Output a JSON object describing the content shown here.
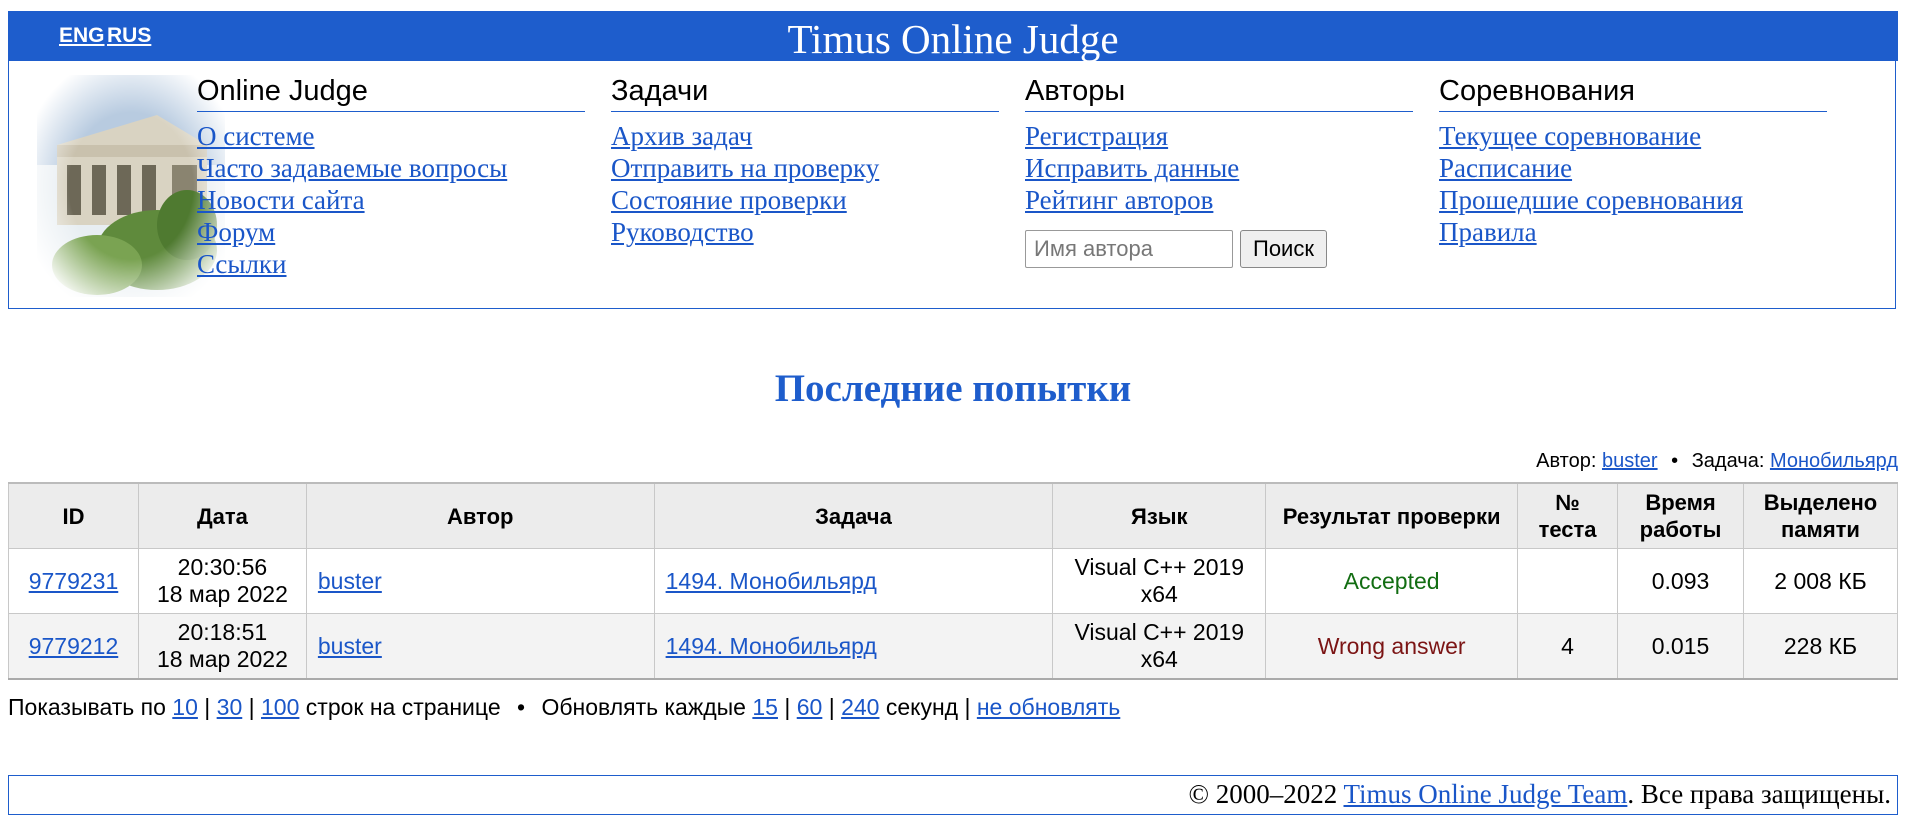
{
  "header": {
    "lang_eng": "ENG",
    "lang_rus": "RUS",
    "title": "Timus Online Judge",
    "bar_color": "#1e5dcc"
  },
  "nav": {
    "columns": [
      {
        "heading": "Online Judge",
        "links": [
          "О системе",
          "Часто задаваемые вопросы",
          "Новости сайта",
          "Форум",
          "Ссылки"
        ]
      },
      {
        "heading": "Задачи",
        "links": [
          "Архив задач",
          "Отправить на проверку",
          "Состояние проверки",
          "Руководство"
        ]
      },
      {
        "heading": "Авторы",
        "links": [
          "Регистрация",
          "Исправить данные",
          "Рейтинг авторов"
        ]
      },
      {
        "heading": "Соревнования",
        "links": [
          "Текущее соревнование",
          "Расписание",
          "Прошедшие соревнования",
          "Правила"
        ]
      }
    ],
    "search": {
      "placeholder": "Имя автора",
      "value": "",
      "button": "Поиск"
    }
  },
  "page_title": "Последние попытки",
  "filter": {
    "author_label": "Автор:",
    "author_value": "buster",
    "separator": "•",
    "problem_label": "Задача:",
    "problem_value": "Монобильярд"
  },
  "table": {
    "headers": {
      "id": "ID",
      "date": "Дата",
      "author": "Автор",
      "problem": "Задача",
      "language": "Язык",
      "verdict": "Результат проверки",
      "test_line1": "№",
      "test_line2": "теста",
      "time_line1": "Время",
      "time_line2": "работы",
      "memory_line1": "Выделено",
      "memory_line2": "памяти"
    },
    "rows": [
      {
        "id": "9779231",
        "time": "20:30:56",
        "date": "18 мар 2022",
        "author": "buster",
        "problem": "1494. Монобильярд",
        "lang_line1": "Visual C++ 2019",
        "lang_line2": "x64",
        "verdict": "Accepted",
        "test": "",
        "run_time": "0.093",
        "memory": "2 008 КБ"
      },
      {
        "id": "9779212",
        "time": "20:18:51",
        "date": "18 мар 2022",
        "author": "buster",
        "problem": "1494. Монобильярд",
        "lang_line1": "Visual C++ 2019",
        "lang_line2": "x64",
        "verdict": "Wrong answer",
        "test": "4",
        "run_time": "0.015",
        "memory": "228 КБ"
      }
    ],
    "verdict_colors": {
      "accepted": "#126d12",
      "wrong": "#7b1414"
    }
  },
  "options": {
    "show_prefix": "Показывать по",
    "show_10": "10",
    "sep": "|",
    "show_30": "30",
    "show_100": "100",
    "show_suffix": "строк на странице",
    "dot": "•",
    "refresh_prefix": "Обновлять каждые",
    "refresh_15": "15",
    "refresh_60": "60",
    "refresh_240": "240",
    "refresh_suffix": "секунд",
    "no_refresh": "не обновлять"
  },
  "footer": {
    "copyright_prefix": "© 2000–2022",
    "team_link": "Timus Online Judge Team",
    "rights": ". Все права защищены."
  }
}
